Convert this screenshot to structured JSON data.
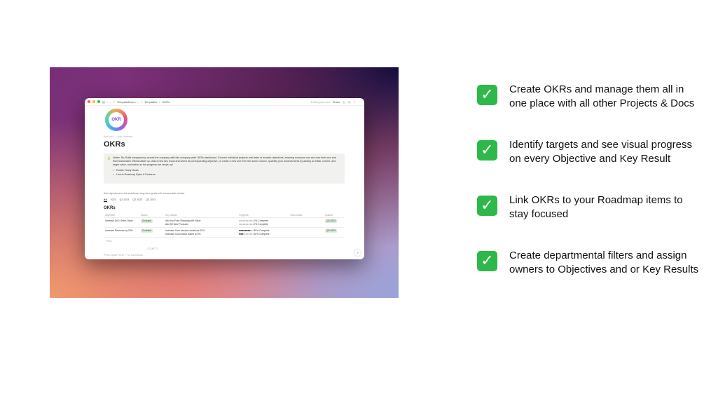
{
  "window": {
    "breadcrumb": [
      "TemplateDocs / ...",
      "Templates",
      "OKRs"
    ],
    "edited_text": "Edited just now",
    "share_label": "Share"
  },
  "page": {
    "logo_text": "OKR",
    "add_icon_label": "Add icon",
    "add_comment_label": "Add comment",
    "title": "OKRs",
    "callout": {
      "text": "Notion Tip: Build transparency across the company with this company-wide OKRs dashboard. Connect individual projects and tasks to broader objectives, ensuring everyone can see how their own and their teammates' efforts ladder up. Add a new key result and select its corresponding objective, or create a new one from the same column. Quantify your achievements by adding an initial, current, and target value, and watch as the progress bar keeps up!",
      "items": [
        "Rotate Yearly Goals",
        "Link to Roadmap Epics & Features"
      ]
    },
    "intro": "Add objectives to set ambitious, long-term goals with measurable results.",
    "tabs": [
      "All",
      "2023",
      "Q1 2023",
      "Q2 2023",
      "Q3 2023"
    ],
    "database_title": "OKRs",
    "columns": [
      "Objective",
      "Status",
      "Key results",
      "Progress",
      "Team leads",
      "Quarter"
    ],
    "rows": [
      {
        "objective": "Increase AVG Order Value",
        "status": "On track",
        "key_results": [
          "Add tool Free Shipping drift Value",
          "Add 50 New Products"
        ],
        "progress": [
          "□□□□□□□□□□ 0% Complete",
          "□□□□□□□□□□ 0% Complete"
        ],
        "quarter": "Q3 2023"
      },
      {
        "objective": "Increase Revenue by 30%",
        "status": "On track",
        "key_results": [
          "Increase User session durations 20%",
          "Increase Conversion Rates to 5%"
        ],
        "progress": [
          "■■■■■■■■□□ 80% Complete",
          "■■■□□□□□□□ 30% Complete"
        ],
        "quarter": "Q3 2023"
      }
    ],
    "new_label": "+ New",
    "count_label": "COUNT 2",
    "footer_hint": "Press 'space' for AI, '/' for commands...",
    "help_label": "?"
  },
  "features": [
    "Create OKRs and manage them all in one place with all other Projects & Docs",
    "Identify targets and see visual progress on every Objective and Key Result",
    "Link OKRs to your Roadmap items to stay focused",
    "Create departmental filters and assign owners to Objectives and or Key Results"
  ],
  "colors": {
    "check_green": "#2fb84a",
    "status_badge": "#dbeddb"
  }
}
